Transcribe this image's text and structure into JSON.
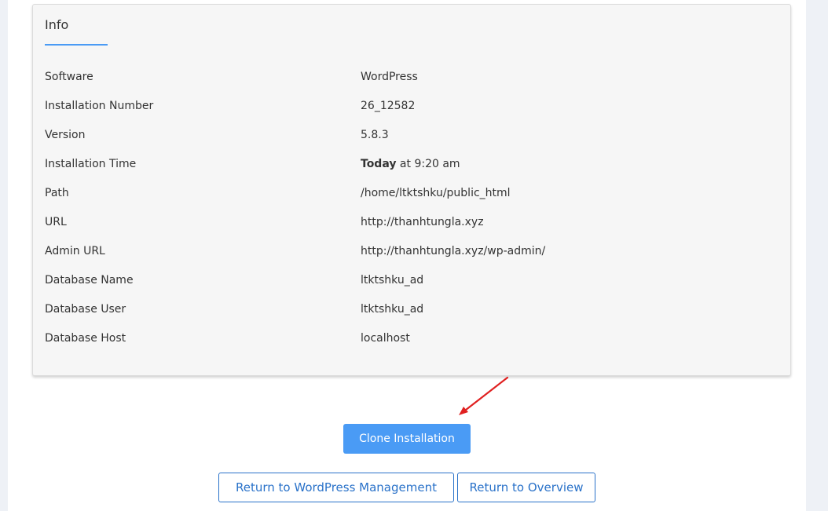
{
  "info": {
    "title": "Info",
    "rows": [
      {
        "label": "Software",
        "value": "WordPress"
      },
      {
        "label": "Installation Number",
        "value": "26_12582"
      },
      {
        "label": "Version",
        "value": "5.8.3"
      },
      {
        "label": "Installation Time",
        "value_bold": "Today",
        "value_rest": " at 9:20 am"
      },
      {
        "label": "Path",
        "value": "/home/ltktshku/public_html"
      },
      {
        "label": "URL",
        "value": "http://thanhtungla.xyz"
      },
      {
        "label": "Admin URL",
        "value": "http://thanhtungla.xyz/wp-admin/"
      },
      {
        "label": "Database Name",
        "value": "ltktshku_ad"
      },
      {
        "label": "Database User",
        "value": "ltktshku_ad"
      },
      {
        "label": "Database Host",
        "value": "localhost"
      }
    ]
  },
  "actions": {
    "clone_label": "Clone Installation",
    "return_mgmt_label": "Return to WordPress Management",
    "return_overview_label": "Return to Overview"
  },
  "colors": {
    "accent": "#4a9bf5",
    "link": "#2a72c9",
    "annotation_arrow": "#e02020"
  }
}
